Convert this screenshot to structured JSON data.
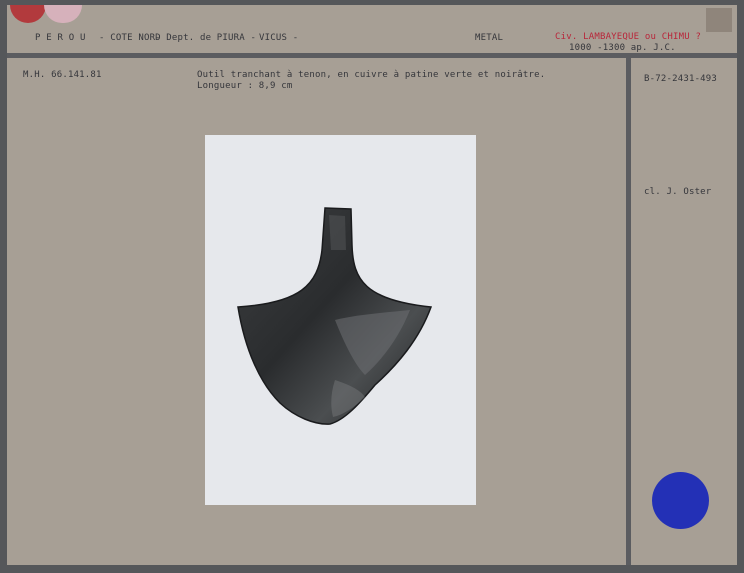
{
  "header": {
    "country": "P E R O U",
    "region": "- COTE NORD",
    "department": "- Dept. de PIURA -",
    "site": "VICUS -",
    "material": "METAL",
    "civilization": "Civ. LAMBAYEQUE  ou CHIMU ?",
    "dates": "1000 -1300 ap. J.C."
  },
  "record": {
    "inventory_number": "M.H. 66.141.81",
    "description_line1": "Outil tranchant à tenon, en cuivre à patine verte et noirâtre.",
    "description_line2": "Longueur : 8,9 cm",
    "photo_ref": "B-72-2431-493",
    "photographer": "cl. J. Oster"
  },
  "colors": {
    "card": "#a79f95",
    "rules": "#5b5c60",
    "red_tab": "#b23a3d",
    "pink_tab": "#d6b1bb",
    "blue_dot": "#2330b6",
    "civ_text": "#b8263a"
  }
}
